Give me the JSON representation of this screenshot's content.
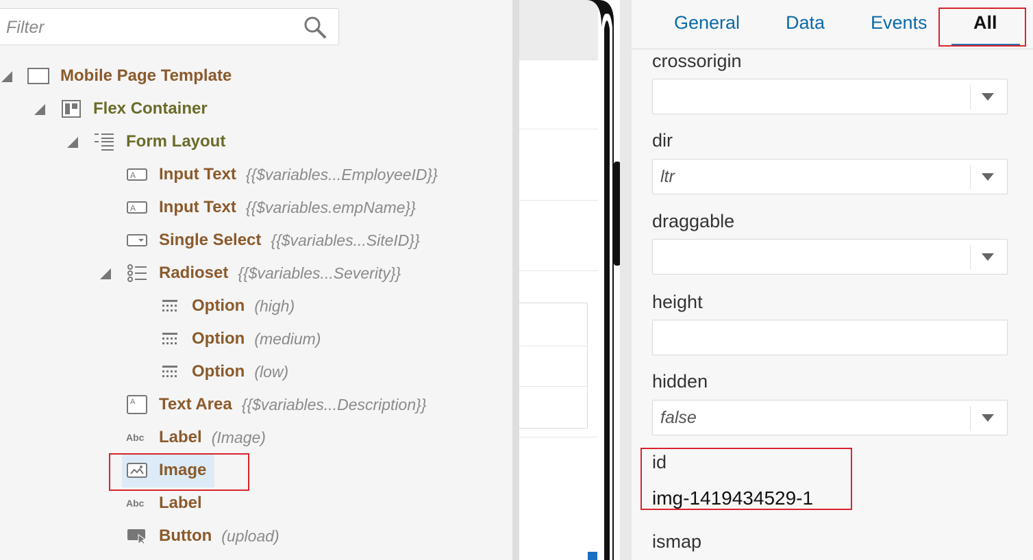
{
  "filter": {
    "placeholder": "Filter"
  },
  "tree": [
    {
      "name": "Mobile Page Template",
      "hint": ""
    },
    {
      "name": "Flex Container",
      "hint": ""
    },
    {
      "name": "Form Layout",
      "hint": ""
    },
    {
      "name": "Input Text",
      "hint": "{{$variables...EmployeeID}}"
    },
    {
      "name": "Input Text",
      "hint": "{{$variables.empName}}"
    },
    {
      "name": "Single Select",
      "hint": "{{$variables...SiteID}}"
    },
    {
      "name": "Radioset",
      "hint": "{{$variables...Severity}}"
    },
    {
      "name": "Option",
      "hint": "(high)"
    },
    {
      "name": "Option",
      "hint": "(medium)"
    },
    {
      "name": "Option",
      "hint": "(low)"
    },
    {
      "name": "Text Area",
      "hint": "{{$variables...Description}}"
    },
    {
      "name": "Label",
      "hint": "(Image)"
    },
    {
      "name": "Image",
      "hint": ""
    },
    {
      "name": "Label",
      "hint": ""
    },
    {
      "name": "Button",
      "hint": "(upload)"
    }
  ],
  "tabs": [
    "General",
    "Data",
    "Events",
    "All"
  ],
  "active_tab": "All",
  "properties": [
    {
      "label": "crossorigin",
      "value": ""
    },
    {
      "label": "dir",
      "value": "ltr"
    },
    {
      "label": "draggable",
      "value": ""
    },
    {
      "label": "height",
      "value": ""
    },
    {
      "label": "hidden",
      "value": "false"
    },
    {
      "label": "id",
      "value": "img-1419434529-1"
    },
    {
      "label": "ismap",
      "value": ""
    }
  ],
  "colors": {
    "tree_name": "#8b5a2b",
    "tab_link": "#0a6aa8",
    "highlight": "#d9232d",
    "selection": "#dcebf7"
  }
}
